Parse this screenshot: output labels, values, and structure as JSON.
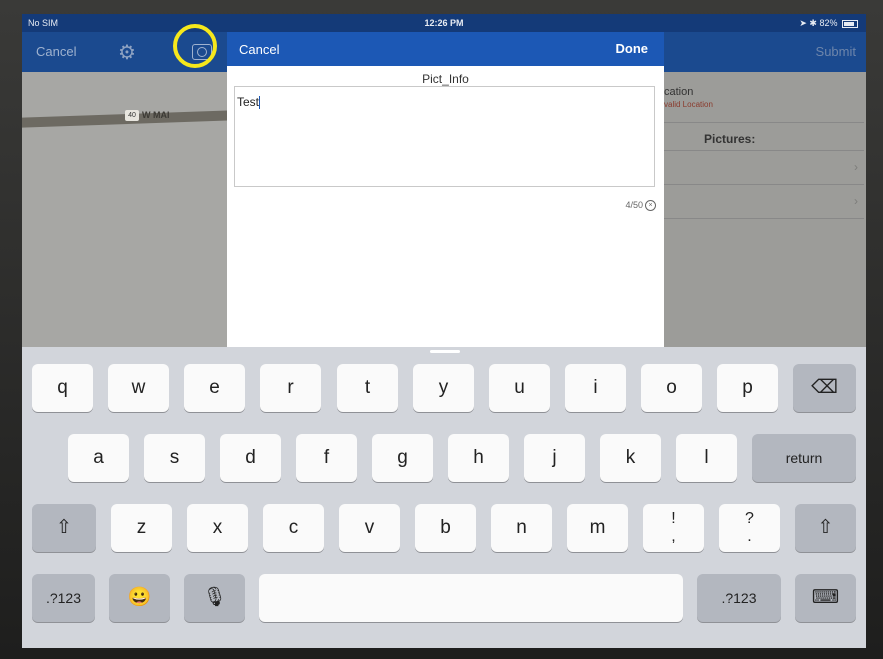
{
  "status_bar": {
    "carrier": "No SIM",
    "time": "12:26 PM",
    "battery": "82%"
  },
  "background_nav": {
    "cancel_label": "Cancel",
    "submit_label": "Submit"
  },
  "background_map": {
    "road_label": "W MAI",
    "route_number": "40"
  },
  "background_panel": {
    "location_label": "cation",
    "invalid_label": "valid Location",
    "pictures_label": "Pictures:"
  },
  "modal": {
    "cancel_label": "Cancel",
    "done_label": "Done",
    "field_title": "Pict_Info",
    "text_value": "Test",
    "counter": "4/50"
  },
  "keyboard": {
    "row1": [
      "q",
      "w",
      "e",
      "r",
      "t",
      "y",
      "u",
      "i",
      "o",
      "p"
    ],
    "row2": [
      "a",
      "s",
      "d",
      "f",
      "g",
      "h",
      "j",
      "k",
      "l"
    ],
    "row3": [
      "z",
      "x",
      "c",
      "v",
      "b",
      "n",
      "m"
    ],
    "punct1": {
      "top": "!",
      "bottom": ","
    },
    "punct2": {
      "top": "?",
      "bottom": "."
    },
    "return_label": "return",
    "numbers_label": ".?123",
    "emoji": "😀",
    "mic": "🎙",
    "shift": "⇧",
    "delete": "⌫",
    "hide": "⌨"
  },
  "colors": {
    "highlight": "#f6e81c",
    "nav": "#1c58b5"
  }
}
